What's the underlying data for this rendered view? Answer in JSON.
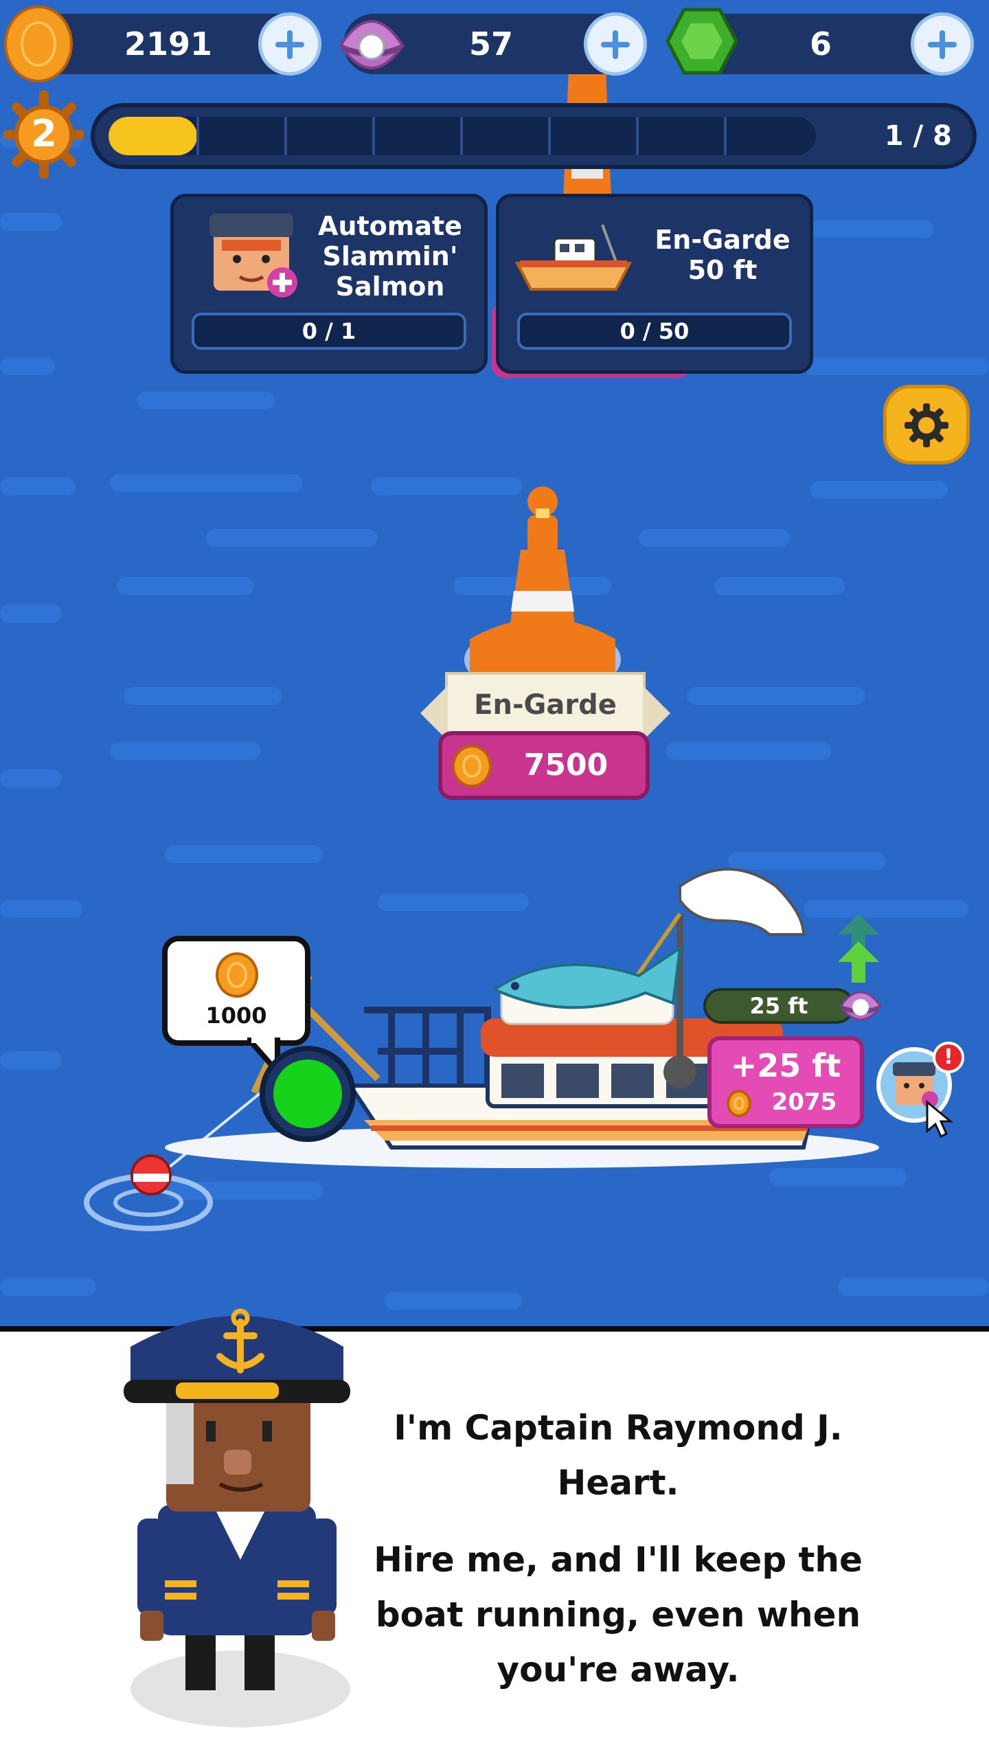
{
  "currency": {
    "coins": "2191",
    "pearls": "57",
    "gems": "6"
  },
  "level": {
    "number": "2",
    "progress_text": "1 / 8",
    "progress_fraction": 0.125
  },
  "cards": [
    {
      "title_lines": [
        "Automate",
        "Slammin'",
        "Salmon"
      ],
      "progress": "0 / 1"
    },
    {
      "title_lines": [
        "En-Garde",
        "50 ft"
      ],
      "progress": "0 / 50"
    }
  ],
  "buoy": {
    "name": "En-Garde",
    "price": "7500"
  },
  "boat": {
    "coin_bubble": "1000",
    "depth_label": "25 ft",
    "upgrade_depth": "+25 ft",
    "upgrade_cost": "2075"
  },
  "dialog": {
    "line1": "I'm Captain Raymond J.",
    "line2": "Heart.",
    "line3": "Hire me, and I'll keep the",
    "line4": "boat running, even when",
    "line5": "you're away."
  },
  "colors": {
    "sea": "#2a68c8",
    "panel": "#1d3566",
    "accent_pink": "#d23fa6",
    "buoy_orange": "#f07a1a",
    "progress_yellow": "#f7c31d"
  }
}
